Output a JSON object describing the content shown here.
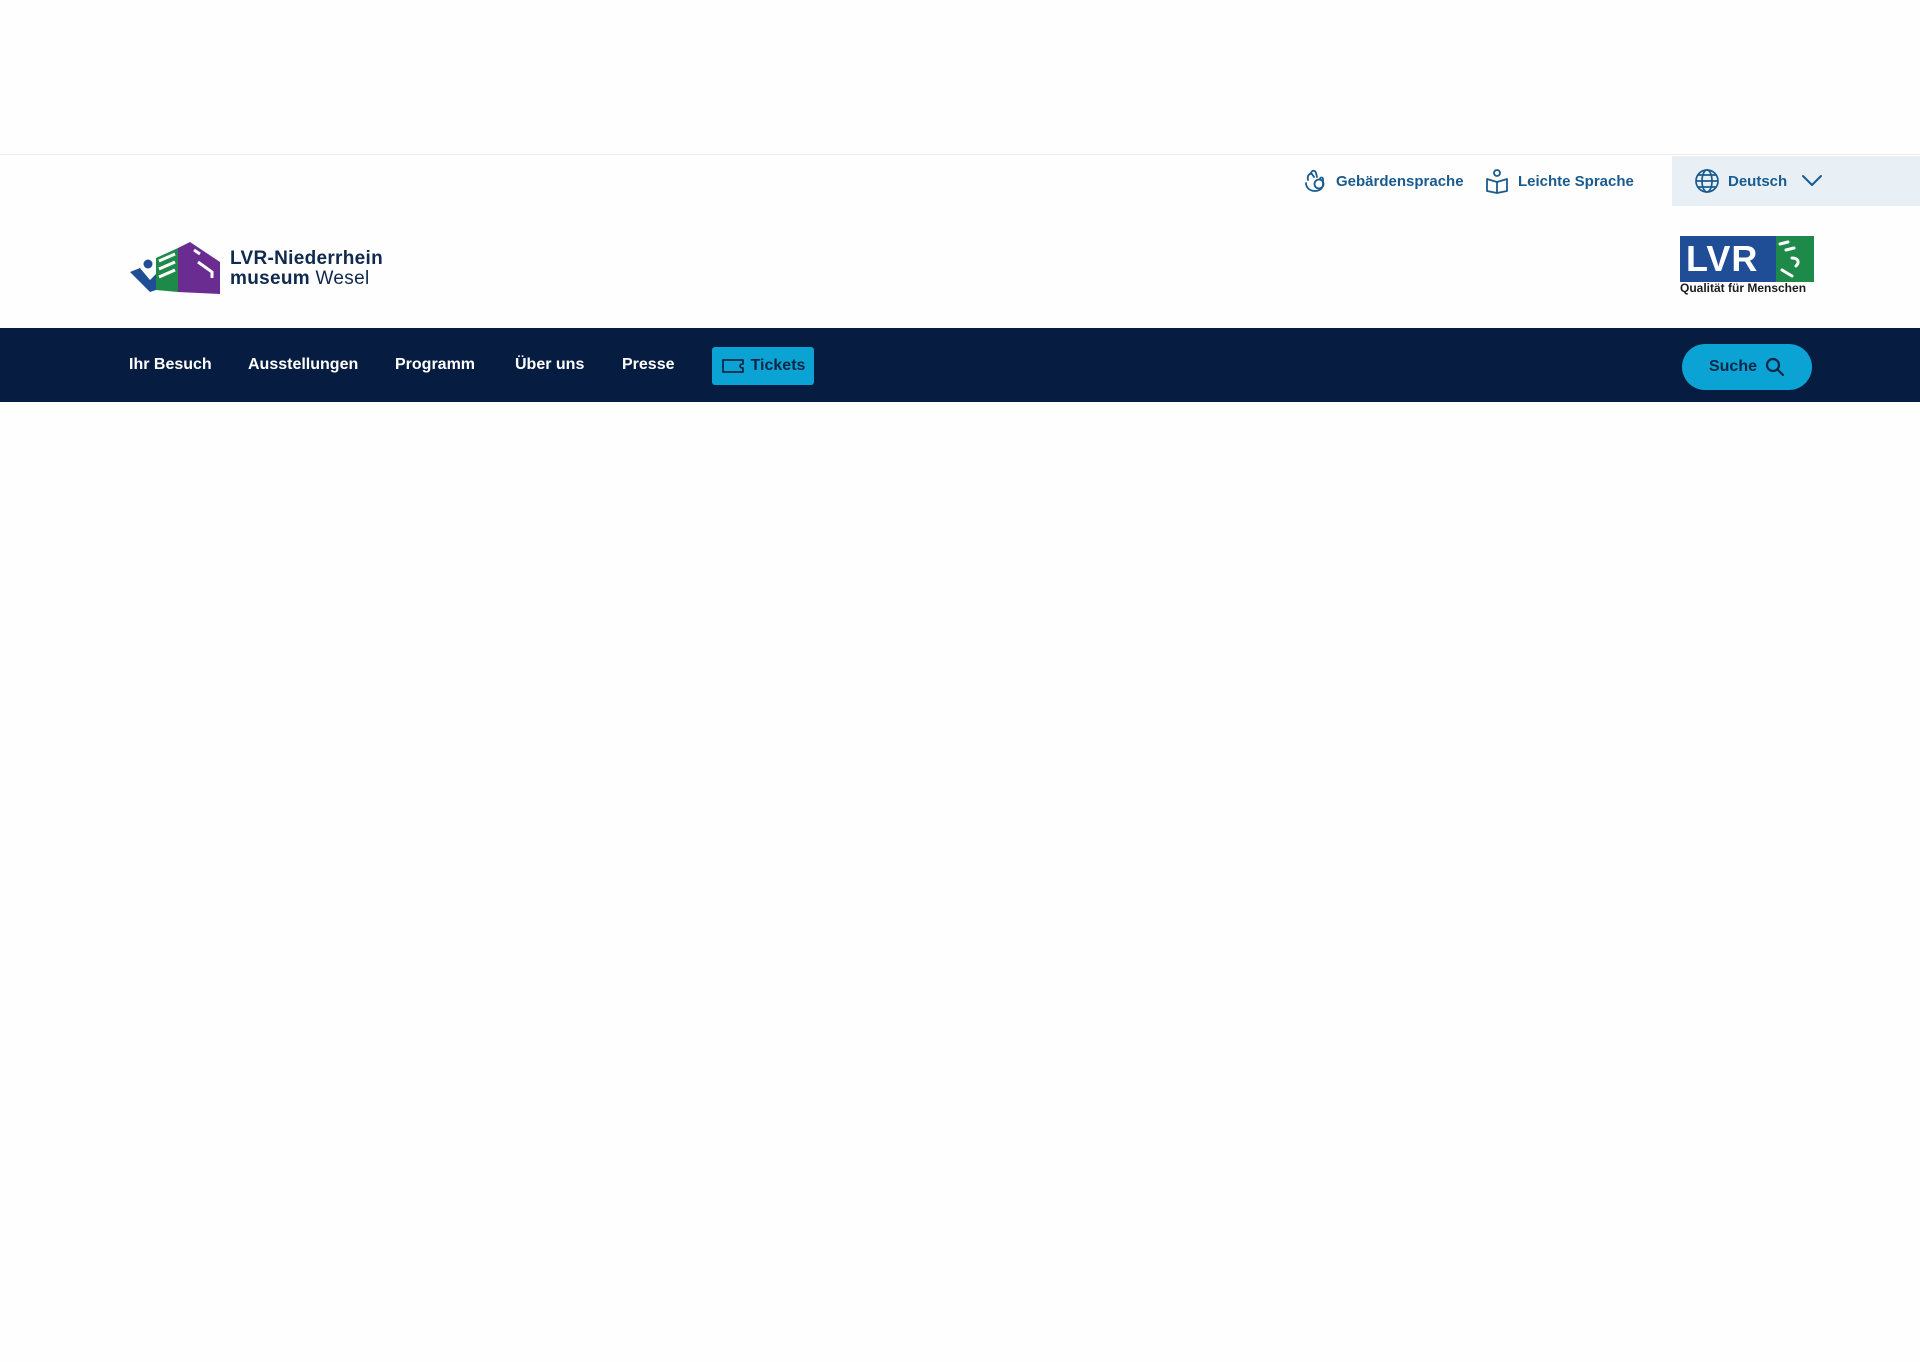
{
  "utility": {
    "sign_language": "Gebärdensprache",
    "easy_language": "Leichte Sprache",
    "language": "Deutsch"
  },
  "brand": {
    "museum_line1": "LVR-Niederrhein",
    "museum_line2_bold": "museum",
    "museum_line2": " Wesel",
    "lvr_text": "LVR",
    "lvr_tagline": "Qualität für Menschen"
  },
  "nav": {
    "items": [
      "Ihr Besuch",
      "Ausstellungen",
      "Programm",
      "Über uns",
      "Presse"
    ],
    "tickets": "Tickets",
    "search": "Suche"
  },
  "colors": {
    "nav_bg": "#061d41",
    "accent": "#0aa3d3",
    "link": "#1a5b8f",
    "lvr_blue": "#1f4e97",
    "lvr_green": "#1e8a4a"
  }
}
